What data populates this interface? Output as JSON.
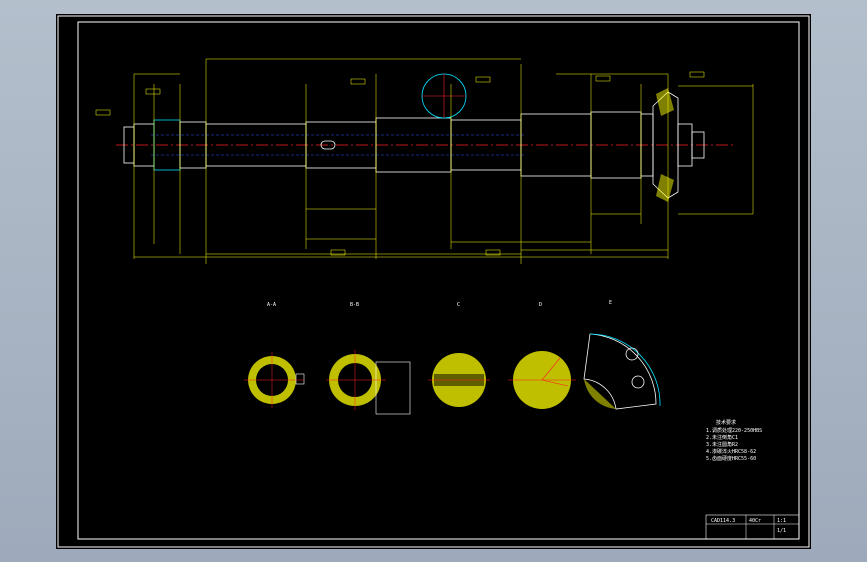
{
  "drawing": {
    "section_labels": [
      "A-A",
      "B-B",
      "C",
      "D",
      "E"
    ],
    "tech_requirements": {
      "title": "技术要求",
      "lines": [
        "1.调质处理220-250HBS",
        "2.未注倒角C1",
        "3.未注圆角R2",
        "4.渗碳淬火HRC58-62",
        "5.齿面硬度HRC55-60"
      ]
    },
    "title_block": {
      "part_name": "CAD114.3",
      "material": "40Cr",
      "scale": "1:1",
      "sheet": "1/1"
    }
  },
  "colors": {
    "sheet": "#000000",
    "outline": "#ffffff",
    "dimension": "#ffff00",
    "centerline": "#ff2020",
    "hidden": "#3050ff",
    "section": "#00e0ff"
  }
}
